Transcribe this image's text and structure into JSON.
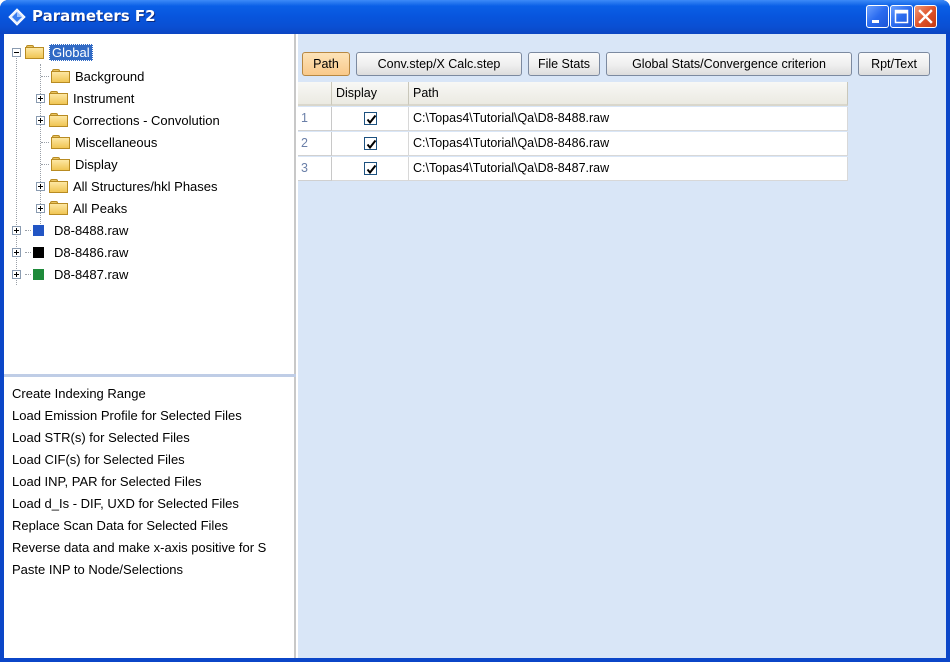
{
  "window": {
    "title": "Parameters F2",
    "controls": [
      "minimize",
      "maximize",
      "close"
    ],
    "icon": "diamond-app-icon"
  },
  "tree": {
    "items": [
      {
        "label": "Global",
        "icon": "folder-icon",
        "expander": "minus",
        "selected": true
      },
      {
        "label": "Background",
        "icon": "folder-icon",
        "expander": null
      },
      {
        "label": "Instrument",
        "icon": "folder-icon",
        "expander": "plus"
      },
      {
        "label": "Corrections - Convolution",
        "icon": "folder-icon",
        "expander": "plus"
      },
      {
        "label": "Miscellaneous",
        "icon": "folder-icon",
        "expander": null
      },
      {
        "label": "Display",
        "icon": "folder-icon",
        "expander": null
      },
      {
        "label": "All Structures/hkl Phases",
        "icon": "folder-icon",
        "expander": "plus"
      },
      {
        "label": "All Peaks",
        "icon": "folder-icon",
        "expander": "plus"
      },
      {
        "label": "D8-8488.raw",
        "color": "#2255c4",
        "expander": "plus"
      },
      {
        "label": "D8-8486.raw",
        "color": "#000000",
        "expander": "plus"
      },
      {
        "label": "D8-8487.raw",
        "color": "#1e8a3a",
        "expander": "plus"
      }
    ]
  },
  "context_menu": {
    "items": [
      "Create Indexing Range",
      "Load Emission Profile for Selected Files",
      "Load STR(s) for Selected Files",
      "Load CIF(s) for Selected Files",
      "Load INP, PAR for Selected Files",
      "Load d_Is - DIF, UXD for Selected Files",
      "Replace Scan Data for Selected Files",
      "Reverse data and make x-axis positive for S",
      "Paste INP to Node/Selections"
    ]
  },
  "toolbar": {
    "buttons": [
      "Path",
      "Conv.step/X Calc.step",
      "File Stats",
      "Global Stats/Convergence criterion",
      "Rpt/Text"
    ],
    "active": "Path"
  },
  "grid": {
    "columns": [
      "",
      "Display",
      "Path"
    ],
    "rows": [
      {
        "num": "1",
        "display": true,
        "path": "C:\\Topas4\\Tutorial\\Qa\\D8-8488.raw"
      },
      {
        "num": "2",
        "display": true,
        "path": "C:\\Topas4\\Tutorial\\Qa\\D8-8486.raw"
      },
      {
        "num": "3",
        "display": true,
        "path": "C:\\Topas4\\Tutorial\\Qa\\D8-8487.raw"
      }
    ]
  },
  "colors": {
    "titlebar": "#0855dd",
    "right_panel_bg": "#d9e6f7",
    "selection": "#316ac5",
    "active_button": "#f9c98a"
  }
}
